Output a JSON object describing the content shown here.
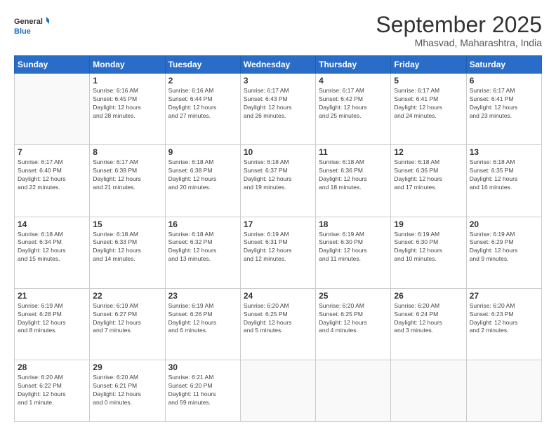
{
  "logo": {
    "general": "General",
    "blue": "Blue"
  },
  "header": {
    "month": "September 2025",
    "location": "Mhasvad, Maharashtra, India"
  },
  "weekdays": [
    "Sunday",
    "Monday",
    "Tuesday",
    "Wednesday",
    "Thursday",
    "Friday",
    "Saturday"
  ],
  "weeks": [
    [
      {
        "day": "",
        "info": ""
      },
      {
        "day": "1",
        "info": "Sunrise: 6:16 AM\nSunset: 6:45 PM\nDaylight: 12 hours\nand 28 minutes."
      },
      {
        "day": "2",
        "info": "Sunrise: 6:16 AM\nSunset: 6:44 PM\nDaylight: 12 hours\nand 27 minutes."
      },
      {
        "day": "3",
        "info": "Sunrise: 6:17 AM\nSunset: 6:43 PM\nDaylight: 12 hours\nand 26 minutes."
      },
      {
        "day": "4",
        "info": "Sunrise: 6:17 AM\nSunset: 6:42 PM\nDaylight: 12 hours\nand 25 minutes."
      },
      {
        "day": "5",
        "info": "Sunrise: 6:17 AM\nSunset: 6:41 PM\nDaylight: 12 hours\nand 24 minutes."
      },
      {
        "day": "6",
        "info": "Sunrise: 6:17 AM\nSunset: 6:41 PM\nDaylight: 12 hours\nand 23 minutes."
      }
    ],
    [
      {
        "day": "7",
        "info": "Sunrise: 6:17 AM\nSunset: 6:40 PM\nDaylight: 12 hours\nand 22 minutes."
      },
      {
        "day": "8",
        "info": "Sunrise: 6:17 AM\nSunset: 6:39 PM\nDaylight: 12 hours\nand 21 minutes."
      },
      {
        "day": "9",
        "info": "Sunrise: 6:18 AM\nSunset: 6:38 PM\nDaylight: 12 hours\nand 20 minutes."
      },
      {
        "day": "10",
        "info": "Sunrise: 6:18 AM\nSunset: 6:37 PM\nDaylight: 12 hours\nand 19 minutes."
      },
      {
        "day": "11",
        "info": "Sunrise: 6:18 AM\nSunset: 6:36 PM\nDaylight: 12 hours\nand 18 minutes."
      },
      {
        "day": "12",
        "info": "Sunrise: 6:18 AM\nSunset: 6:36 PM\nDaylight: 12 hours\nand 17 minutes."
      },
      {
        "day": "13",
        "info": "Sunrise: 6:18 AM\nSunset: 6:35 PM\nDaylight: 12 hours\nand 16 minutes."
      }
    ],
    [
      {
        "day": "14",
        "info": "Sunrise: 6:18 AM\nSunset: 6:34 PM\nDaylight: 12 hours\nand 15 minutes."
      },
      {
        "day": "15",
        "info": "Sunrise: 6:18 AM\nSunset: 6:33 PM\nDaylight: 12 hours\nand 14 minutes."
      },
      {
        "day": "16",
        "info": "Sunrise: 6:18 AM\nSunset: 6:32 PM\nDaylight: 12 hours\nand 13 minutes."
      },
      {
        "day": "17",
        "info": "Sunrise: 6:19 AM\nSunset: 6:31 PM\nDaylight: 12 hours\nand 12 minutes."
      },
      {
        "day": "18",
        "info": "Sunrise: 6:19 AM\nSunset: 6:30 PM\nDaylight: 12 hours\nand 11 minutes."
      },
      {
        "day": "19",
        "info": "Sunrise: 6:19 AM\nSunset: 6:30 PM\nDaylight: 12 hours\nand 10 minutes."
      },
      {
        "day": "20",
        "info": "Sunrise: 6:19 AM\nSunset: 6:29 PM\nDaylight: 12 hours\nand 9 minutes."
      }
    ],
    [
      {
        "day": "21",
        "info": "Sunrise: 6:19 AM\nSunset: 6:28 PM\nDaylight: 12 hours\nand 8 minutes."
      },
      {
        "day": "22",
        "info": "Sunrise: 6:19 AM\nSunset: 6:27 PM\nDaylight: 12 hours\nand 7 minutes."
      },
      {
        "day": "23",
        "info": "Sunrise: 6:19 AM\nSunset: 6:26 PM\nDaylight: 12 hours\nand 6 minutes."
      },
      {
        "day": "24",
        "info": "Sunrise: 6:20 AM\nSunset: 6:25 PM\nDaylight: 12 hours\nand 5 minutes."
      },
      {
        "day": "25",
        "info": "Sunrise: 6:20 AM\nSunset: 6:25 PM\nDaylight: 12 hours\nand 4 minutes."
      },
      {
        "day": "26",
        "info": "Sunrise: 6:20 AM\nSunset: 6:24 PM\nDaylight: 12 hours\nand 3 minutes."
      },
      {
        "day": "27",
        "info": "Sunrise: 6:20 AM\nSunset: 6:23 PM\nDaylight: 12 hours\nand 2 minutes."
      }
    ],
    [
      {
        "day": "28",
        "info": "Sunrise: 6:20 AM\nSunset: 6:22 PM\nDaylight: 12 hours\nand 1 minute."
      },
      {
        "day": "29",
        "info": "Sunrise: 6:20 AM\nSunset: 6:21 PM\nDaylight: 12 hours\nand 0 minutes."
      },
      {
        "day": "30",
        "info": "Sunrise: 6:21 AM\nSunset: 6:20 PM\nDaylight: 11 hours\nand 59 minutes."
      },
      {
        "day": "",
        "info": ""
      },
      {
        "day": "",
        "info": ""
      },
      {
        "day": "",
        "info": ""
      },
      {
        "day": "",
        "info": ""
      }
    ]
  ]
}
